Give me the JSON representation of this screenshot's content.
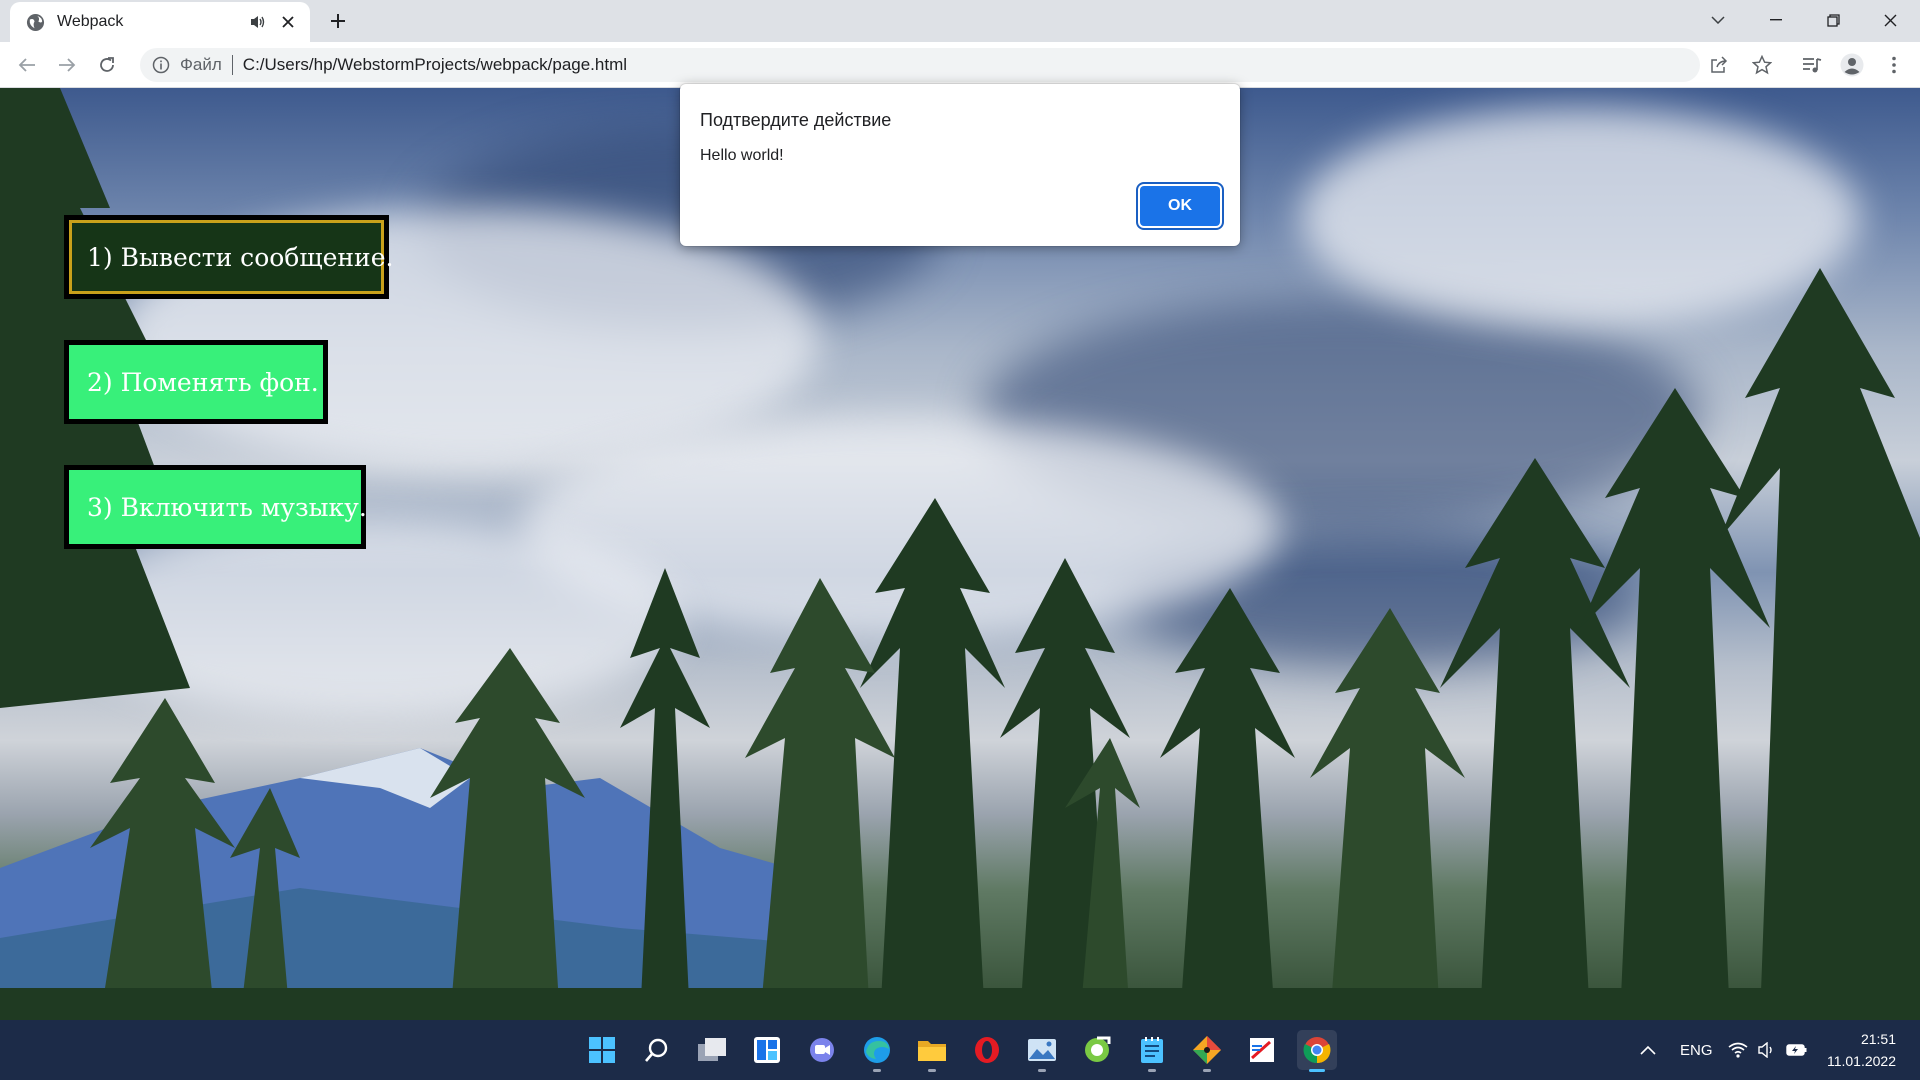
{
  "tab": {
    "title": "Webpack"
  },
  "address_bar": {
    "scheme_label": "Файл",
    "url": "C:/Users/hp/WebstormProjects/webpack/page.html"
  },
  "page": {
    "buttons": [
      {
        "label": "1) Вывести сообщение."
      },
      {
        "label": "2) Поменять фон."
      },
      {
        "label": "3) Включить музыку."
      }
    ]
  },
  "dialog": {
    "title": "Подтвердите действие",
    "message": "Hello world!",
    "ok_label": "OK"
  },
  "taskbar": {
    "apps": [
      "start-icon",
      "search-icon",
      "task-view-icon",
      "widgets-icon",
      "teams-chat-icon",
      "edge-icon",
      "file-explorer-icon",
      "opera-icon",
      "photos-icon",
      "app-green-icon",
      "notepad-icon",
      "git-icon",
      "app-editor-icon",
      "chrome-icon"
    ],
    "language": "ENG",
    "time": "21:51",
    "date": "11.01.2022"
  },
  "colors": {
    "button_green": "#38f07a",
    "button_dark": "#163517",
    "button_border_gold": "#c9a11b",
    "dialog_ok": "#1a73e8",
    "taskbar": "#1c2b48"
  }
}
